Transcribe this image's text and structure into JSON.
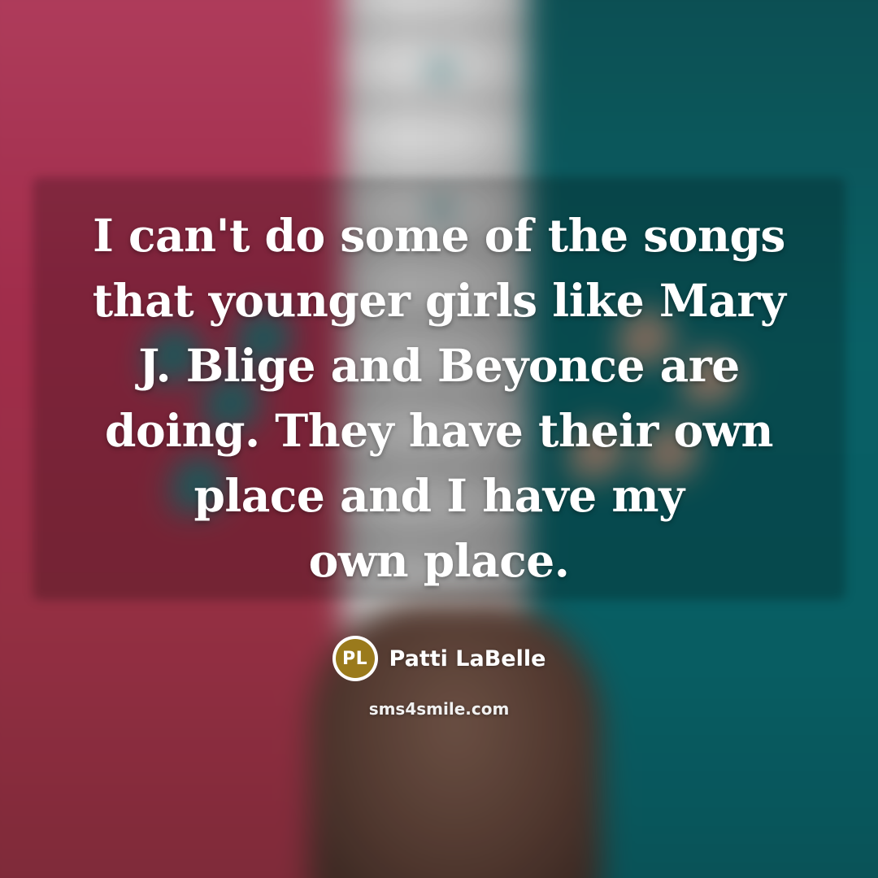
{
  "quote": {
    "lines": [
      "I can't do some of the songs",
      "that younger girls like Mary",
      "J. Blige and Beyonce are",
      "doing. They have their own",
      "place and I have my",
      "own place."
    ]
  },
  "author": {
    "initials": "PL",
    "name": "Patti LaBelle",
    "badge_color": "#9a7a1c"
  },
  "site": "sms4smile.com",
  "colors": {
    "left_background": "#b83456",
    "right_background": "#0b6e74",
    "text": "#ffffff"
  }
}
